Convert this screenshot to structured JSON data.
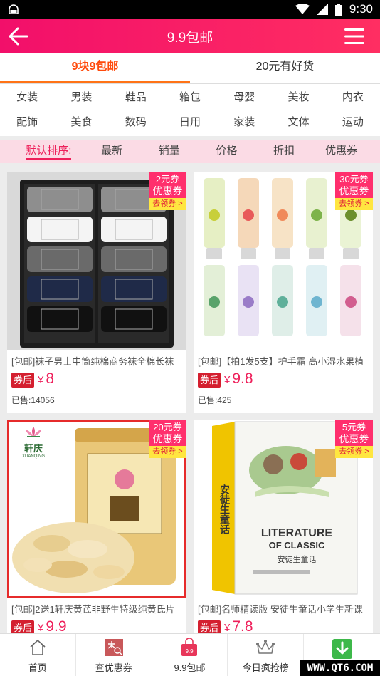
{
  "status_bar": {
    "time": "9:30"
  },
  "header": {
    "title": "9.9包邮"
  },
  "tabs": [
    {
      "label": "9块9包邮",
      "active": true
    },
    {
      "label": "20元有好货",
      "active": false
    }
  ],
  "categories": [
    [
      "女装",
      "男装",
      "鞋品",
      "箱包",
      "母婴",
      "美妆",
      "内衣"
    ],
    [
      "配饰",
      "美食",
      "数码",
      "日用",
      "家装",
      "文体",
      "运动"
    ]
  ],
  "sort": [
    "默认排序:",
    "最新",
    "销量",
    "价格",
    "折扣",
    "优惠券"
  ],
  "products": [
    {
      "name": "[包邮]袜子男士中筒纯棉商务袜全棉长袜",
      "coupon_amount": "2元券",
      "coupon_label": "优惠券",
      "coupon_action": "去领券 >",
      "price_badge": "券后",
      "currency": "¥",
      "price": "8",
      "sold": "已售:14056",
      "image": "socks-image"
    },
    {
      "name": "[包邮]【拍1发5支】护手霜 高小湿水果植",
      "coupon_amount": "30元券",
      "coupon_label": "优惠券",
      "coupon_action": "去领券 >",
      "price_badge": "券后",
      "currency": "¥",
      "price": "9.8",
      "sold": "已售:425",
      "image": "hand-cream-image"
    },
    {
      "name": "[包邮]2送1轩庆黄芪非野生特级纯黄氏片",
      "coupon_amount": "20元券",
      "coupon_label": "优惠券",
      "coupon_action": "去领券 >",
      "price_badge": "券后",
      "currency": "¥",
      "price": "9.9",
      "brand": "轩庆",
      "brand_en": "XUANQING",
      "image": "astragalus-image"
    },
    {
      "name": "[包邮]名师精读版 安徒生童话小学生新课",
      "coupon_amount": "5元券",
      "coupon_label": "优惠券",
      "coupon_action": "去领券 >",
      "price_badge": "券后",
      "currency": "¥",
      "price": "7.8",
      "book_title": "LITERATURE",
      "book_subtitle": "OF CLASSIC",
      "book_cn": "安徒生童话",
      "book_spine": "安徒生童话",
      "image": "book-image"
    }
  ],
  "bottom_nav": [
    {
      "label": "首页",
      "icon": "home-icon"
    },
    {
      "label": "查优惠券",
      "icon": "coupon-search-icon"
    },
    {
      "label": "9.9包邮",
      "icon": "shopping-bag-icon",
      "badge": "9.9"
    },
    {
      "label": "今日疯抢榜",
      "icon": "crown-icon"
    },
    {
      "label": "",
      "icon": "download-icon"
    }
  ],
  "watermark": "WWW.QT6.COM"
}
